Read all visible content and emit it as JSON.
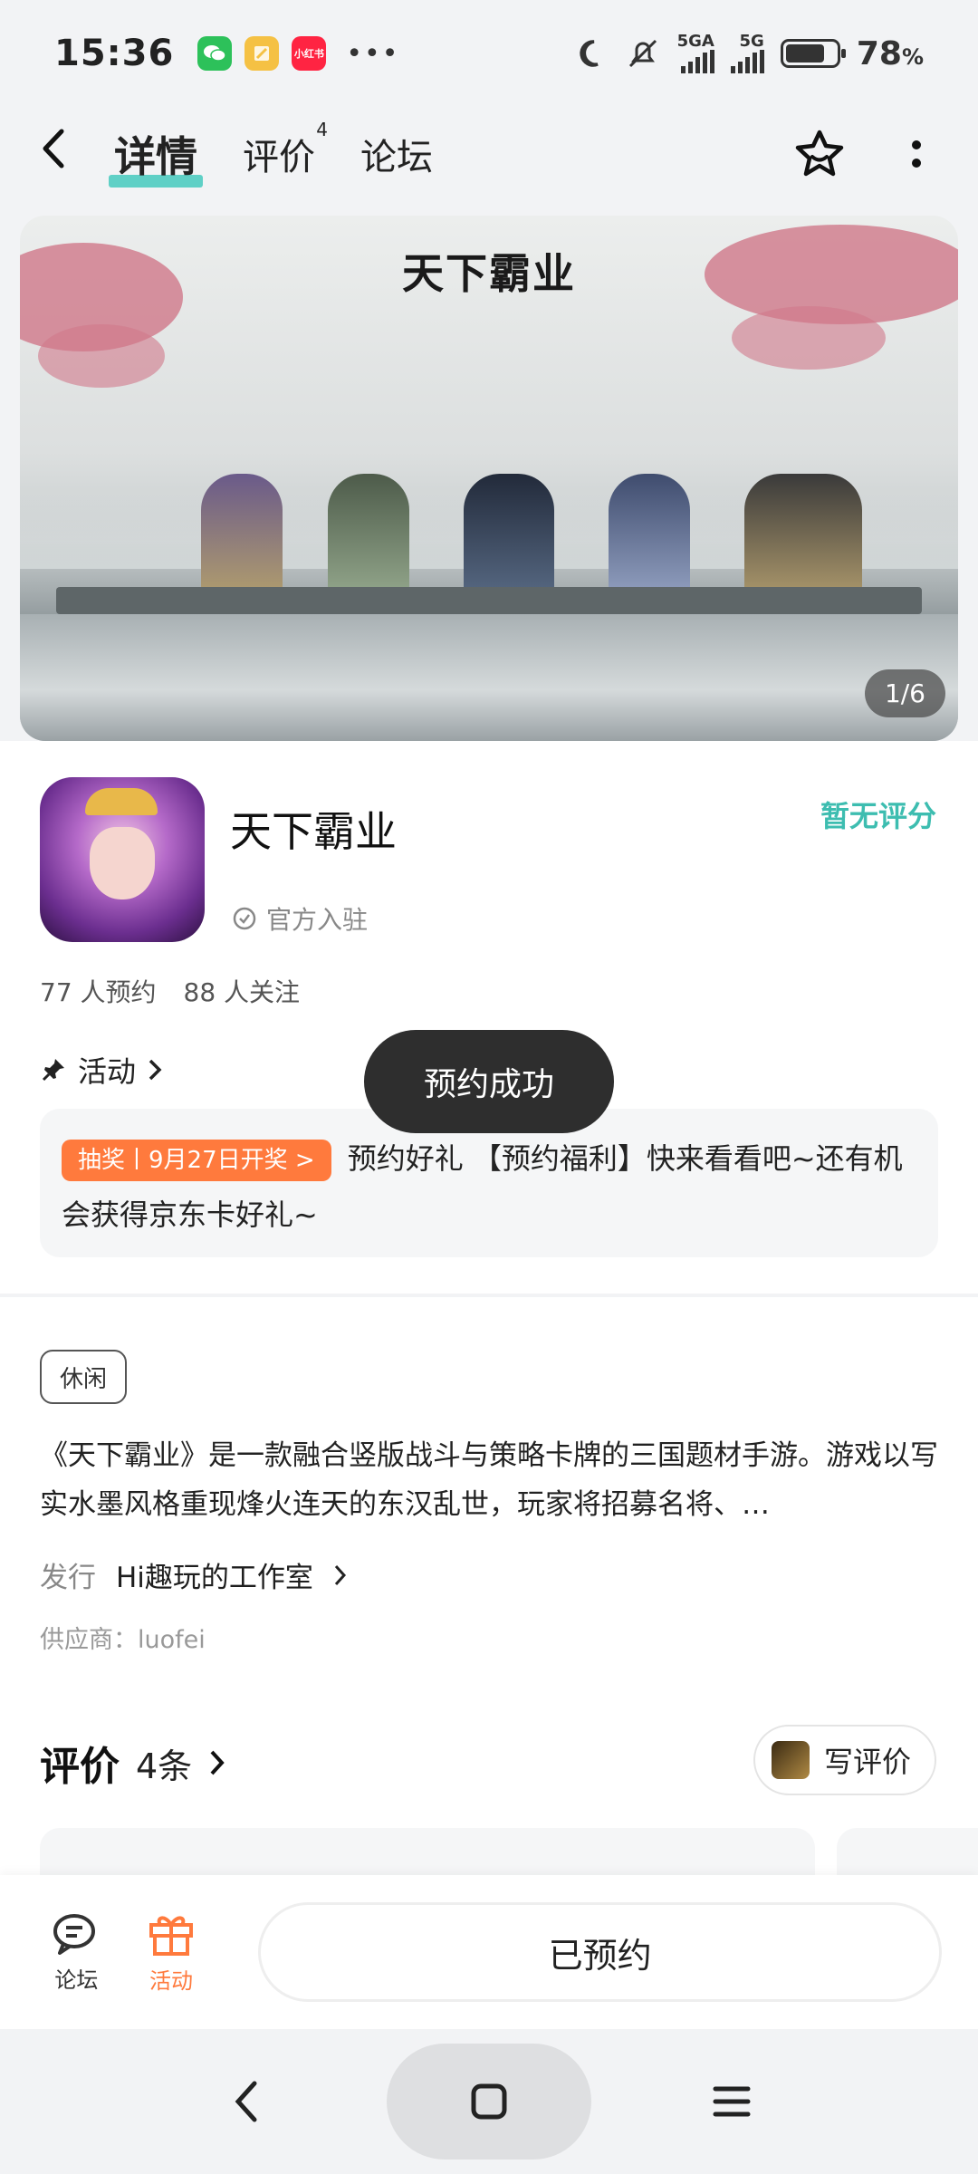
{
  "status": {
    "time": "15:36",
    "net1": "5GA",
    "net2": "5G",
    "battery_percent": "78",
    "battery_suffix": "%",
    "battery_level": 0.78,
    "apps": [
      "wechat-icon",
      "notes-icon",
      "xiaohongshu-icon"
    ],
    "xhs_label": "小红书"
  },
  "nav": {
    "tabs": [
      {
        "label": "详情"
      },
      {
        "label": "评价",
        "badge": "4"
      },
      {
        "label": "论坛"
      }
    ]
  },
  "banner": {
    "logo": "天下霸业",
    "page_indicator": "1/6"
  },
  "game": {
    "title": "天下霸业",
    "official_label": "官方入驻",
    "rating": "暂无评分",
    "reservations": "77 人预约",
    "followers": "88 人关注"
  },
  "activity": {
    "header": "活动",
    "tag": "抽奖丨9月27日开奖 >",
    "text": "预约好礼 【预约福利】快来看看吧~还有机会获得京东卡好礼~"
  },
  "toast": "预约成功",
  "details": {
    "genre": "休闲",
    "description": "《天下霸业》是一款融合竖版战斗与策略卡牌的三国题材手游。游戏以写实水墨风格重现烽火连天的东汉乱世，玩家将招募名将、…",
    "publisher_label": "发行",
    "publisher": "Hi趣玩的工作室",
    "supplier": "供应商：luofei"
  },
  "reviews": {
    "title": "评价",
    "count": "4条",
    "write_label": "写评价"
  },
  "bottom_bar": {
    "forum_label": "论坛",
    "activity_label": "活动",
    "reserved_label": "已预约"
  },
  "colors": {
    "accent_teal": "#3dbdb0",
    "orange": "#ff7a3d",
    "toast_bg": "#2e2e2e"
  }
}
